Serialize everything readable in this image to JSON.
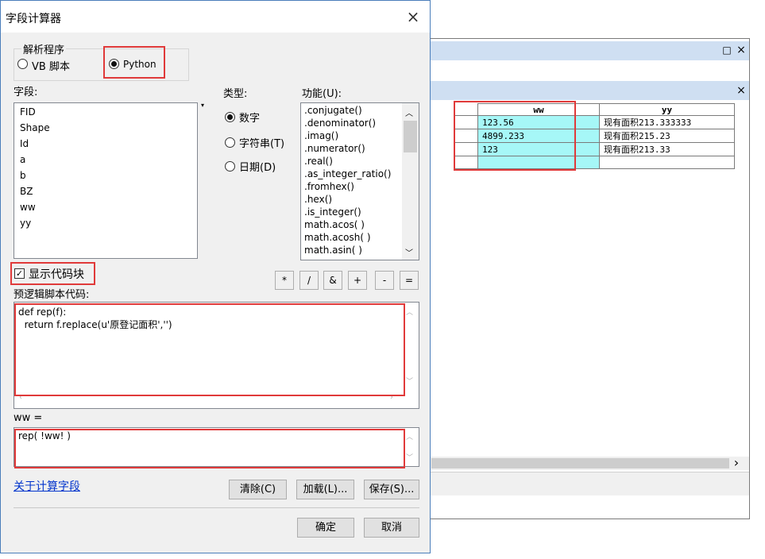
{
  "attr_window": {
    "pin_icon": "□",
    "close_icon": "×",
    "table_close_icon": "×",
    "scroll_right_icon": "›",
    "columns": [
      "ww",
      "yy"
    ],
    "rows": [
      {
        "ww": "123.56",
        "yy": "现有面积213.333333"
      },
      {
        "ww": "4899.233",
        "yy": "现有面积215.23"
      },
      {
        "ww": "123",
        "yy": "现有面积213.33"
      },
      {
        "ww": "",
        "yy": ""
      }
    ]
  },
  "dialog": {
    "title": "字段计算器",
    "close_icon": "×",
    "parser": {
      "legend": "解析程序",
      "options": [
        "VB 脚本",
        "Python"
      ],
      "selected": "Python"
    },
    "fields_label": "字段:",
    "fields": [
      "FID",
      "Shape",
      "Id",
      "a",
      "b",
      "BZ",
      "ww",
      "yy"
    ],
    "type_label": "类型:",
    "types": [
      "数字",
      "字符串(T)",
      "日期(D)"
    ],
    "selected_type": "数字",
    "functions_label": "功能(U):",
    "functions": [
      ".conjugate()",
      ".denominator()",
      ".imag()",
      ".numerator()",
      ".real()",
      ".as_integer_ratio()",
      ".fromhex()",
      ".hex()",
      ".is_integer()",
      "math.acos( )",
      "math.acosh( )",
      "math.asin( )"
    ],
    "operators": [
      "*",
      "/",
      "&",
      "+",
      "-",
      "="
    ],
    "show_codeblock_label": "显示代码块",
    "show_codeblock_checked": true,
    "prelogic_label": "预逻辑脚本代码:",
    "prelogic_lines": [
      "def rep(f):",
      "  return f.replace(u'原登记面积','')"
    ],
    "expression_label": "ww =",
    "expression": "rep( !ww! )",
    "about_link": "关于计算字段",
    "buttons": {
      "clear": "清除(C)",
      "load": "加载(L)...",
      "save": "保存(S)...",
      "ok": "确定",
      "cancel": "取消"
    },
    "scroll_up_icon": "︿",
    "scroll_down_icon": "﹀"
  }
}
